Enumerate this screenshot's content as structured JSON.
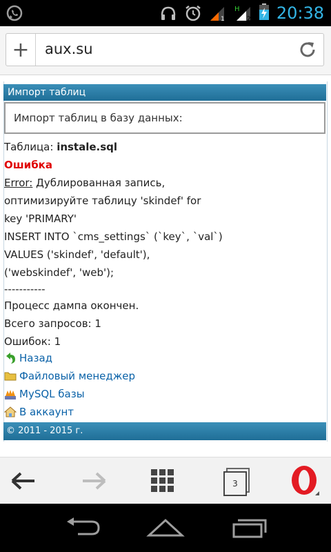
{
  "status_bar": {
    "time": "20:38",
    "network_label_h": "H",
    "sim1": "1",
    "sim2": "2"
  },
  "address_bar": {
    "url": "aux.su"
  },
  "page": {
    "header_title": "Импорт таблиц",
    "import_box_text": "Импорт таблиц в базу данных:",
    "table_label": "Таблица:",
    "table_name": "instale.sql",
    "error_title": "Ошибка",
    "error_label": "Error:",
    "error_line1": " Дублированная запись,",
    "error_line2": "оптимизируйте таблицу 'skindef' for",
    "error_line3": "key 'PRIMARY'",
    "sql_line1": "INSERT INTO `cms_settings` (`key`,  `val`)",
    "sql_line2": "VALUES ('skindef',  'default'),",
    "sql_line3": "('webskindef',  'web');",
    "separator": "-----------",
    "dump_done": "Процесс дампа окончен.",
    "total_queries": "Всего запросов: 1",
    "errors_count": "Ошибок: 1",
    "links": [
      {
        "label": "Назад",
        "icon": "back-arrow-icon"
      },
      {
        "label": "Файловый менеджер",
        "icon": "folder-icon"
      },
      {
        "label": "MySQL базы",
        "icon": "pma-icon"
      },
      {
        "label": "В аккаунт",
        "icon": "home-icon"
      }
    ],
    "footer": "© 2011 - 2015 г."
  },
  "browser_toolbar": {
    "tabs_count": "3"
  },
  "colors": {
    "accent": "#33b5e5",
    "header_bar": "#2b7fa9",
    "error_red": "#e00000",
    "link_blue": "#0a62a8",
    "opera_red": "#e31b23"
  }
}
